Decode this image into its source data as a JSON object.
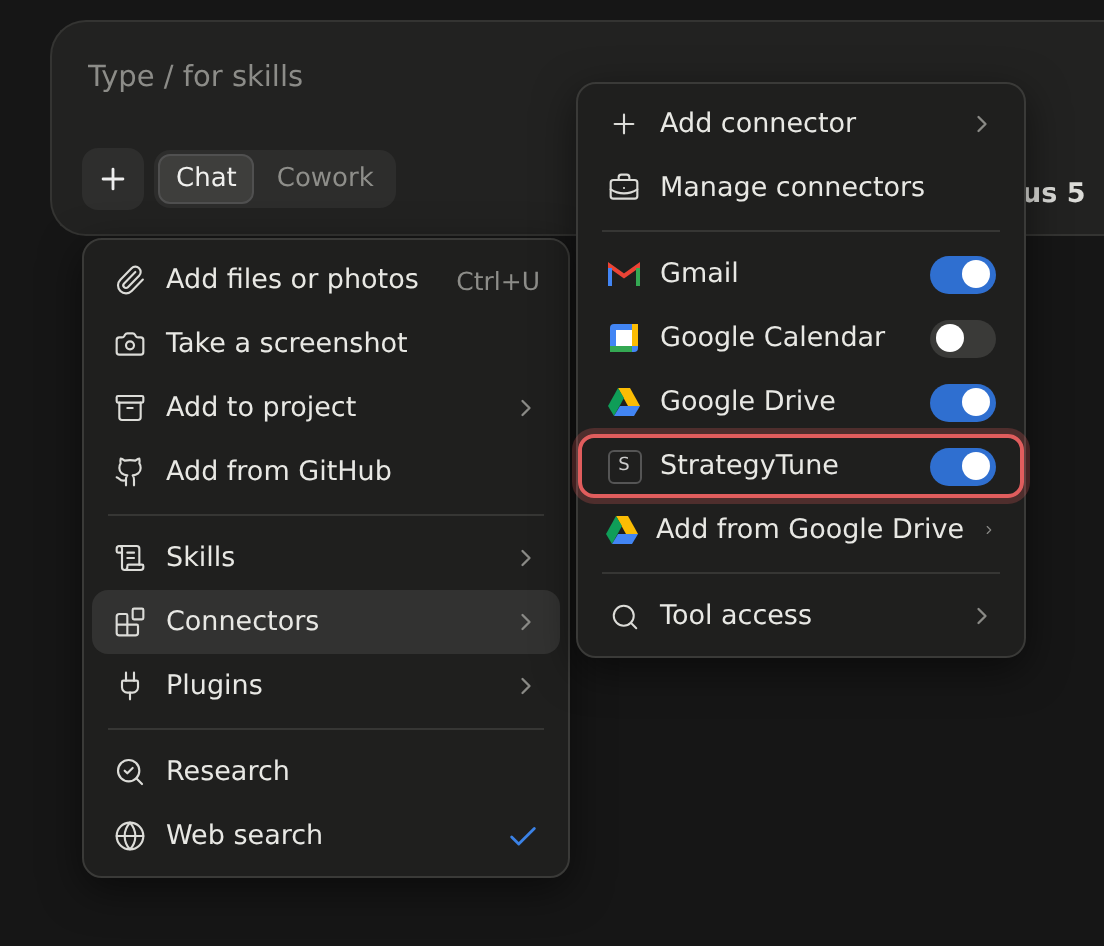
{
  "composer": {
    "placeholder": "Type / for skills",
    "modes": [
      {
        "label": "Chat",
        "selected": true
      },
      {
        "label": "Cowork",
        "selected": false
      }
    ],
    "model_label": "us 5"
  },
  "menu": {
    "groups": [
      [
        {
          "kind": "action",
          "label": "Add files or photos",
          "shortcut": "Ctrl+U",
          "selected": false
        },
        {
          "kind": "action",
          "label": "Take a screenshot",
          "selected": false
        },
        {
          "kind": "submenu",
          "label": "Add to project",
          "selected": false
        },
        {
          "kind": "action",
          "label": "Add from GitHub",
          "selected": false
        }
      ],
      [
        {
          "kind": "submenu",
          "label": "Skills",
          "selected": false
        },
        {
          "kind": "submenu",
          "label": "Connectors",
          "selected": true
        },
        {
          "kind": "submenu",
          "label": "Plugins",
          "selected": false
        }
      ],
      [
        {
          "kind": "check",
          "label": "Research",
          "checked": false,
          "selected": false
        },
        {
          "kind": "check",
          "label": "Web search",
          "checked": true,
          "selected": false
        }
      ]
    ]
  },
  "submenu": {
    "top": [
      {
        "kind": "submenu",
        "label": "Add connector"
      },
      {
        "kind": "action",
        "label": "Manage connectors"
      }
    ],
    "connectors": [
      {
        "kind": "toggle",
        "label": "Gmail",
        "on": true,
        "outlined": false
      },
      {
        "kind": "toggle",
        "label": "Google Calendar",
        "on": false,
        "outlined": false
      },
      {
        "kind": "toggle",
        "label": "Google Drive",
        "on": true,
        "outlined": false
      },
      {
        "kind": "toggle",
        "label": "StrategyTune",
        "badge": "S",
        "on": true,
        "outlined": true
      },
      {
        "kind": "submenu",
        "label": "Add from Google Drive",
        "outlined": false
      }
    ],
    "bottom": [
      {
        "kind": "submenu",
        "label": "Tool access"
      }
    ]
  }
}
